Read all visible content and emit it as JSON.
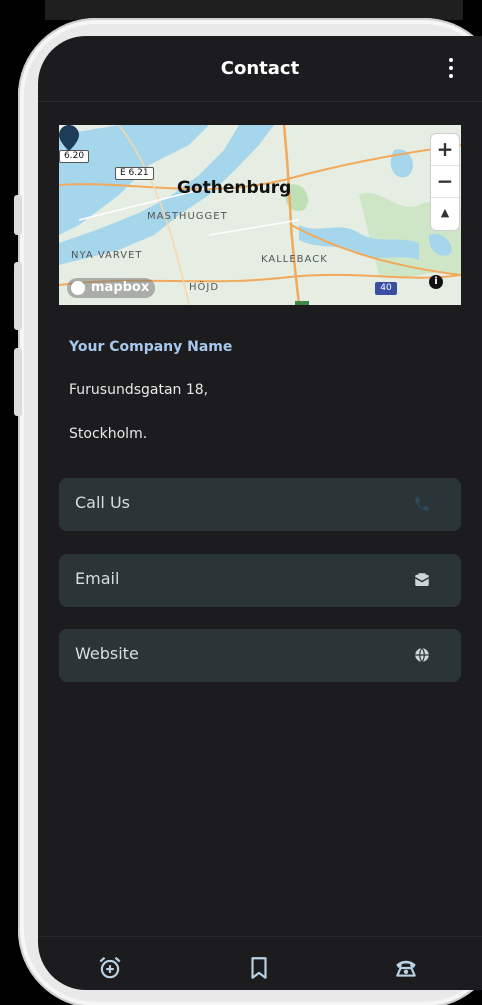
{
  "header": {
    "title": "Contact",
    "more_icon": "more-vert-icon"
  },
  "map": {
    "city": "Gothenburg",
    "districts": [
      "MASTHUGGET",
      "NYA VARVET",
      "KALLEBACK",
      "HÖJD"
    ],
    "road_shields": [
      "6.20",
      "E 6.21",
      "40"
    ],
    "attribution_logo": "mapbox",
    "controls": {
      "zoom_in": "+",
      "zoom_out": "−",
      "compass": "▲",
      "info": "i"
    }
  },
  "company": {
    "name": "Your Company Name",
    "address_line1": "Furusundsgatan 18,",
    "address_line2": "Stockholm."
  },
  "actions": [
    {
      "label": "Call Us",
      "icon": "phone-icon"
    },
    {
      "label": "Email",
      "icon": "email-icon"
    },
    {
      "label": "Website",
      "icon": "globe-icon"
    }
  ],
  "bottom_nav": [
    {
      "icon": "alarm-add-icon"
    },
    {
      "icon": "bookmark-icon"
    },
    {
      "icon": "phone-icon"
    }
  ],
  "colors": {
    "background": "#1c1c1e",
    "accent": "#a7c8ec",
    "button_bg": "#2b3537"
  }
}
